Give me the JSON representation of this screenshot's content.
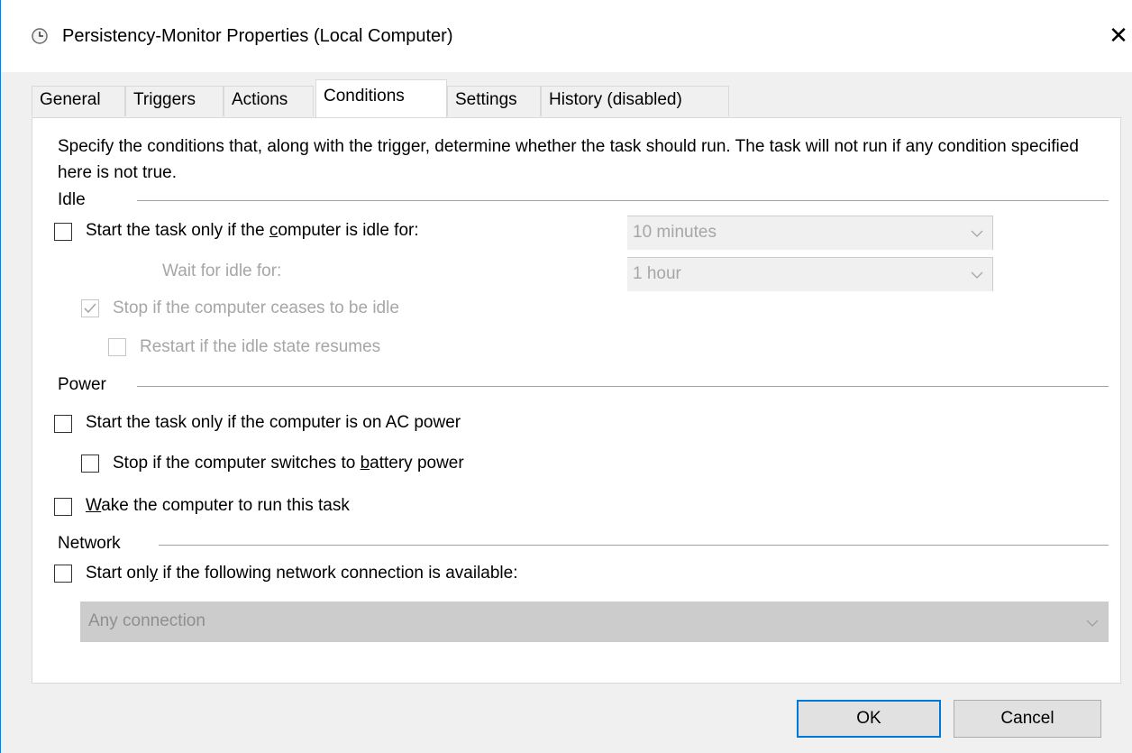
{
  "window": {
    "title": "Persistency-Monitor Properties (Local Computer)",
    "close_glyph": "✕",
    "icon": "clock-icon"
  },
  "tabs": [
    {
      "label": "General"
    },
    {
      "label": "Triggers"
    },
    {
      "label": "Actions"
    },
    {
      "label": "Conditions",
      "active": true
    },
    {
      "label": "Settings"
    },
    {
      "label": "History (disabled)"
    }
  ],
  "conditions": {
    "description": "Specify the conditions that, along with the trigger, determine whether the task should run.  The task will not run  if any condition specified here is not true.",
    "idle": {
      "group_label": "Idle",
      "start_if_idle": {
        "label_before": "Start the task only if the ",
        "accel": "c",
        "label_after": "omputer is idle for:",
        "checked": false
      },
      "idle_for_value": "10 minutes",
      "wait_label": "Wait for idle for:",
      "wait_value": "1 hour",
      "stop_if_ceases": {
        "label": "Stop if the computer ceases to be idle",
        "checked": true,
        "disabled": true
      },
      "restart_if_resumes": {
        "label": "Restart if the idle state resumes",
        "checked": false,
        "disabled": true
      }
    },
    "power": {
      "group_label": "Power",
      "ac_power": {
        "label": "Start the task only if the computer is on AC power",
        "checked": false
      },
      "battery": {
        "label_before": "Stop if the computer switches to ",
        "accel": "b",
        "label_after": "attery power",
        "checked": false
      },
      "wake": {
        "label_before": "",
        "accel": "W",
        "label_after": "ake the computer to run this task",
        "checked": false
      }
    },
    "network": {
      "group_label": "Network",
      "start_only_if": {
        "label_before": "Start onl",
        "accel": "y",
        "label_after": " if the following network connection is available:",
        "checked": false
      },
      "connection_value": "Any connection"
    }
  },
  "buttons": {
    "ok": "OK",
    "cancel": "Cancel"
  }
}
